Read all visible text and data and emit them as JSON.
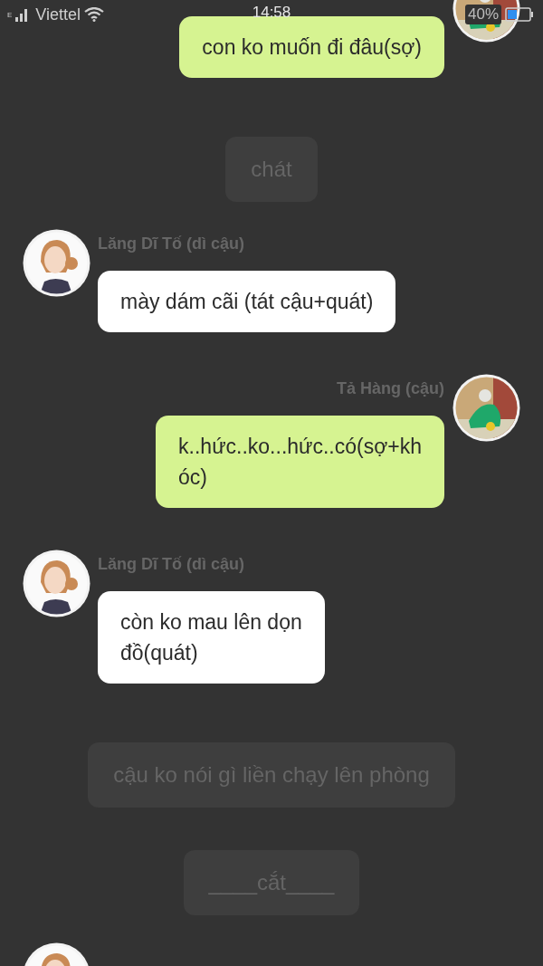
{
  "status_bar": {
    "network_type": "E",
    "carrier": "Viettel",
    "time": "14:58",
    "battery_percent": "40%"
  },
  "messages": [
    {
      "kind": "outgoing",
      "lines": [
        "con ko muốn đi đâu(sợ)"
      ]
    },
    {
      "kind": "narration",
      "text": "chát"
    },
    {
      "kind": "incoming",
      "name": "Lăng Dĩ Tố (dì cậu)",
      "lines": [
        "mày dám cãi (tát cậu+quát)"
      ]
    },
    {
      "kind": "outgoing",
      "name": "Tả Hàng (cậu)",
      "lines": [
        "k..hức..ko...hức..có(sợ+kh",
        "óc)"
      ]
    },
    {
      "kind": "incoming",
      "name": "Lăng Dĩ Tố (dì cậu)",
      "lines": [
        "còn ko mau lên dọn",
        "đồ(quát)"
      ]
    },
    {
      "kind": "narration",
      "text": "cậu ko nói gì liền chạy lên phòng"
    },
    {
      "kind": "narration",
      "text": "____cắt____"
    },
    {
      "kind": "avatar_only"
    }
  ]
}
